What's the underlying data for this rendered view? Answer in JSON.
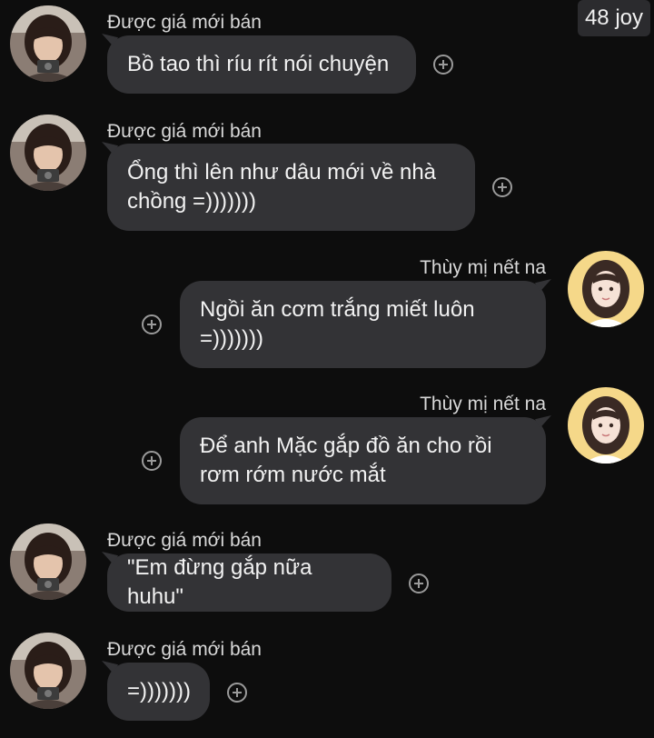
{
  "watermark": "48 joy",
  "messages": [
    {
      "sender": "Được giá mới bán",
      "text": "Bồ tao thì ríu rít nói chuyện",
      "avatar": "girl-photo-avatar"
    },
    {
      "sender": "Được giá mới bán",
      "text": "Ổng thì lên như dâu mới về nhà\nchồng =)))))))",
      "avatar": "girl-photo-avatar"
    },
    {
      "sender": "Thùy mị nết na",
      "text": "Ngồi ăn cơm trắng miết luôn\n=)))))))",
      "avatar": "anime-girl-avatar"
    },
    {
      "sender": "Thùy mị nết na",
      "text": "Để anh Mặc gắp đồ ăn cho rồi\nrơm rớm nước mắt",
      "avatar": "anime-girl-avatar"
    },
    {
      "sender": "Được giá mới bán",
      "text": "\"Em đừng gắp nữa huhu\"",
      "avatar": "girl-photo-avatar"
    },
    {
      "sender": "Được giá mới bán",
      "text": "=)))))))",
      "avatar": "girl-photo-avatar"
    }
  ],
  "icons": {
    "react": "plus-circle-icon"
  },
  "colors": {
    "background": "#0d0d0d",
    "bubble": "#333336",
    "text": "#f2f2f2",
    "icon": "#9a9a9a"
  }
}
